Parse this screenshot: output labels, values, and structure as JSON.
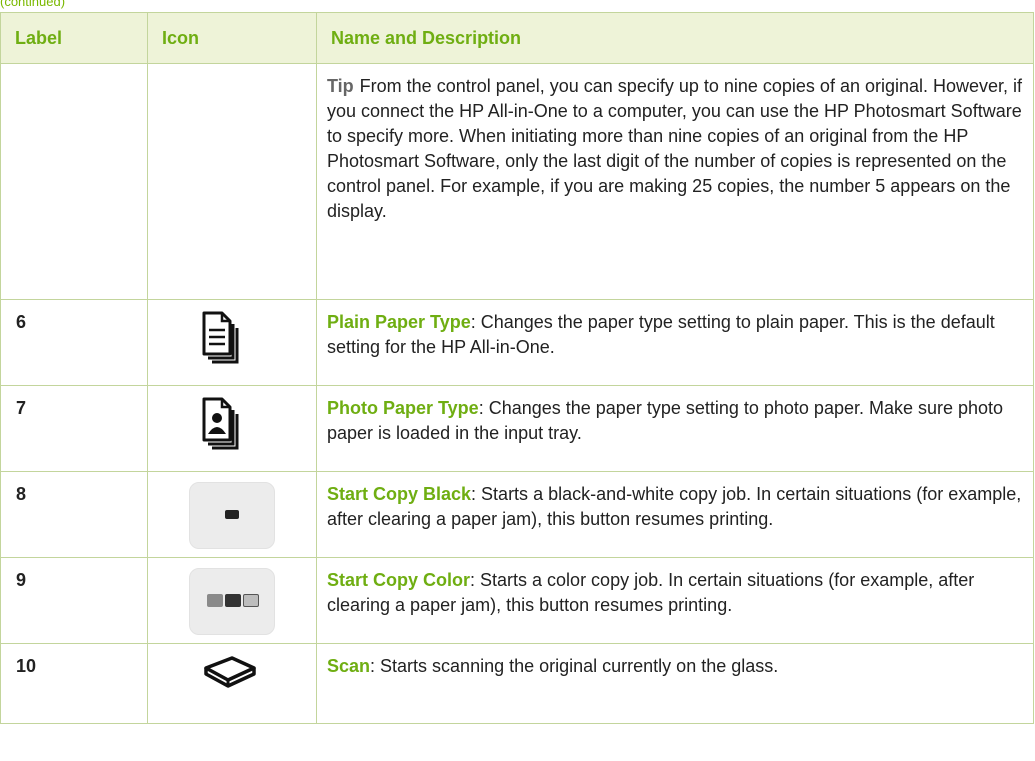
{
  "continued_label": "(continued)",
  "table": {
    "headers": {
      "label": "Label",
      "icon": "Icon",
      "name": "Name and Description"
    },
    "tip": {
      "keyword": "Tip",
      "text": "From the control panel, you can specify up to nine copies of an original. However, if you connect the HP All-in-One to a computer, you can use the HP Photosmart Software to specify more. When initiating more than nine copies of an original from the HP Photosmart Software, only the last digit of the number of copies is represented on the control panel. For example, if you are making 25 copies, the number 5 appears on the display."
    },
    "rows": [
      {
        "label": "6",
        "icon": "plain-paper-icon",
        "name": "Plain Paper Type",
        "desc": ": Changes the paper type setting to plain paper. This is the default setting for the HP All-in-One."
      },
      {
        "label": "7",
        "icon": "photo-paper-icon",
        "name": "Photo Paper Type",
        "desc": ": Changes the paper type setting to photo paper. Make sure photo paper is loaded in the input tray."
      },
      {
        "label": "8",
        "icon": "start-copy-black-button-icon",
        "name": "Start Copy Black",
        "desc": ": Starts a black-and-white copy job. In certain situations (for example, after clearing a paper jam), this button resumes printing."
      },
      {
        "label": "9",
        "icon": "start-copy-color-button-icon",
        "name": "Start Copy Color",
        "desc": ": Starts a color copy job. In certain situations (for example, after clearing a paper jam), this button resumes printing."
      },
      {
        "label": "10",
        "icon": "scan-icon",
        "name": "Scan",
        "desc": ": Starts scanning the original currently on the glass."
      }
    ]
  },
  "colors": {
    "accent_green": "#6fae12",
    "header_bg": "#eef3d8",
    "border": "#c3d59c"
  }
}
